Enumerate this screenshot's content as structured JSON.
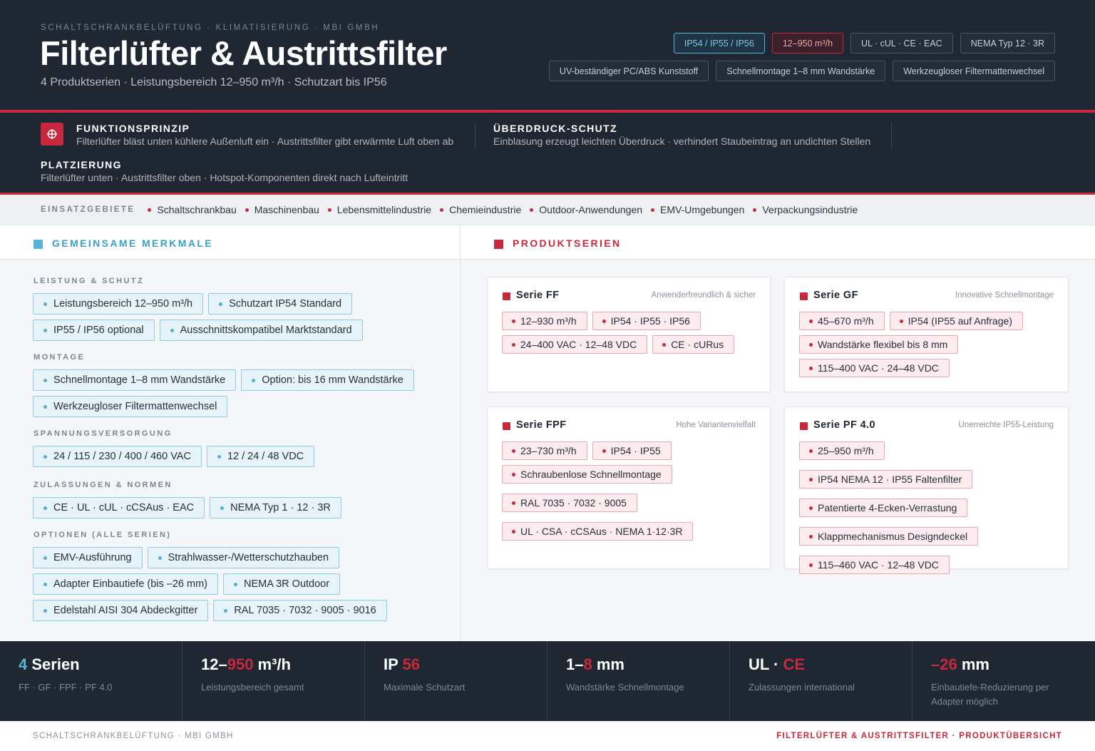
{
  "header": {
    "eyebrow": "SCHALTSCHRANKBELÜFTUNG · KLIMATISIERUNG · MBI GMBH",
    "title": "Filterlüfter & Austrittsfilter",
    "subtitle": "4 Produktserien · Leistungsbereich 12–950 m³/h · Schutzart bis IP56",
    "badges_row1": [
      "IP54 / IP55 / IP56",
      "12–950 m³/h",
      "UL · cUL · CE · EAC",
      "NEMA Typ 12 · 3R"
    ],
    "badges_row2": [
      "UV-beständiger PC/ABS Kunststoff",
      "Schnellmontage 1–8 mm Wandstärke",
      "Werkzeugloser Filtermattenwechsel"
    ]
  },
  "info": {
    "icon": "crosshair-icon",
    "funktion": {
      "title": "FUNKTIONSPRINZIP",
      "text": "Filterlüfter bläst unten kühlere Außenluft ein · Austrittsfilter gibt erwärmte Luft oben ab"
    },
    "ueberdruck": {
      "title": "ÜBERDRUCK-SCHUTZ",
      "text": "Einblasung erzeugt leichten Überdruck · verhindert Staubeintrag an undichten Stellen"
    },
    "platzierung": {
      "title": "PLATZIERUNG",
      "text": "Filterlüfter unten · Austrittsfilter oben · Hotspot-Komponenten direkt nach Lufteintritt"
    }
  },
  "einsatz": {
    "label": "EINSATZGEBIETE",
    "items": [
      "Schaltschrankbau",
      "Maschinenbau",
      "Lebensmittelindustrie",
      "Chemieindustrie",
      "Outdoor-Anwendungen",
      "EMV-Umgebungen",
      "Verpackungsindustrie"
    ]
  },
  "merkmale": {
    "title": "GEMEINSAME MERKMALE",
    "groups": [
      {
        "title": "LEISTUNG & SCHUTZ",
        "items": [
          "Leistungsbereich 12–950 m³/h",
          "Schutzart IP54 Standard",
          "IP55 / IP56 optional",
          "Ausschnittskompatibel Marktstandard"
        ]
      },
      {
        "title": "MONTAGE",
        "items": [
          "Schnellmontage 1–8 mm Wandstärke",
          "Option: bis 16 mm Wandstärke",
          "Werkzeugloser Filtermattenwechsel"
        ]
      },
      {
        "title": "SPANNUNGSVERSORGUNG",
        "items": [
          "24 / 115 / 230 / 400 / 460 VAC",
          "12 / 24 / 48 VDC"
        ]
      },
      {
        "title": "ZULASSUNGEN & NORMEN",
        "items": [
          "CE · UL · cUL · cCSAus · EAC",
          "NEMA Typ 1 · 12 · 3R"
        ]
      },
      {
        "title": "OPTIONEN (ALLE SERIEN)",
        "items": [
          "EMV-Ausführung",
          "Strahlwasser-/Wetterschutzhauben",
          "Adapter Einbautiefe (bis –26 mm)",
          "NEMA 3R Outdoor",
          "Edelstahl AISI 304 Abdeckgitter",
          "RAL 7035 · 7032 · 9005 · 9016"
        ]
      }
    ]
  },
  "serien": {
    "title": "PRODUKTSERIEN",
    "cards": [
      {
        "name": "Serie FF",
        "tagline": "Anwenderfreundlich & sicher",
        "items": [
          "12–930 m³/h",
          "IP54 · IP55 · IP56",
          "24–400 VAC · 12–48 VDC",
          "CE · cURus"
        ]
      },
      {
        "name": "Serie GF",
        "tagline": "Innovative Schnellmontage",
        "items": [
          "45–670 m³/h",
          "IP54 (IP55 auf Anfrage)",
          "Wandstärke flexibel bis 8 mm",
          "115–400 VAC · 24–48 VDC"
        ]
      },
      {
        "name": "Serie FPF",
        "tagline": "Hohe Variantenvielfalt",
        "items": [
          "23–730 m³/h",
          "IP54 · IP55",
          "Schraubenlose Schnellmontage",
          "RAL 7035 · 7032 · 9005",
          "UL · CSA · cCSAus · NEMA 1·12·3R"
        ]
      },
      {
        "name": "Serie PF 4.0",
        "tagline": "Unerreichte IP55-Leistung",
        "items": [
          "25–950 m³/h",
          "IP54 NEMA 12 · IP55 Faltenfilter",
          "Patentierte 4-Ecken-Verrastung",
          "Klappmechanismus Designdeckel",
          "115–460 VAC · 12–48 VDC"
        ]
      }
    ]
  },
  "stats": [
    {
      "parts": [
        {
          "t": "4",
          "c": "b"
        },
        {
          "t": " Serien",
          "c": ""
        }
      ],
      "label": "FF · GF · FPF · PF 4.0"
    },
    {
      "parts": [
        {
          "t": "12–",
          "c": ""
        },
        {
          "t": "950",
          "c": "r"
        },
        {
          "t": " m³/h",
          "c": ""
        }
      ],
      "label": "Leistungsbereich gesamt"
    },
    {
      "parts": [
        {
          "t": "IP ",
          "c": ""
        },
        {
          "t": "56",
          "c": "r"
        }
      ],
      "label": "Maximale Schutzart"
    },
    {
      "parts": [
        {
          "t": "1–",
          "c": ""
        },
        {
          "t": "8",
          "c": "r"
        },
        {
          "t": " mm",
          "c": ""
        }
      ],
      "label": "Wandstärke Schnellmontage"
    },
    {
      "parts": [
        {
          "t": "UL · ",
          "c": ""
        },
        {
          "t": "CE",
          "c": "r"
        }
      ],
      "label": "Zulassungen international"
    },
    {
      "parts": [
        {
          "t": "–26",
          "c": "r"
        },
        {
          "t": " mm",
          "c": ""
        }
      ],
      "label": "Einbautiefe-Reduzierung per Adapter möglich"
    }
  ],
  "footer": {
    "left": "SCHALTSCHRANKBELÜFTUNG · MBI GMBH",
    "right": "FILTERLÜFTER & AUSTRITTSFILTER · PRODUKTÜBERSICHT"
  },
  "colors": {
    "dark": "#1f2733",
    "accent_red": "#c8283d",
    "accent_blue": "#5ab4d8"
  }
}
